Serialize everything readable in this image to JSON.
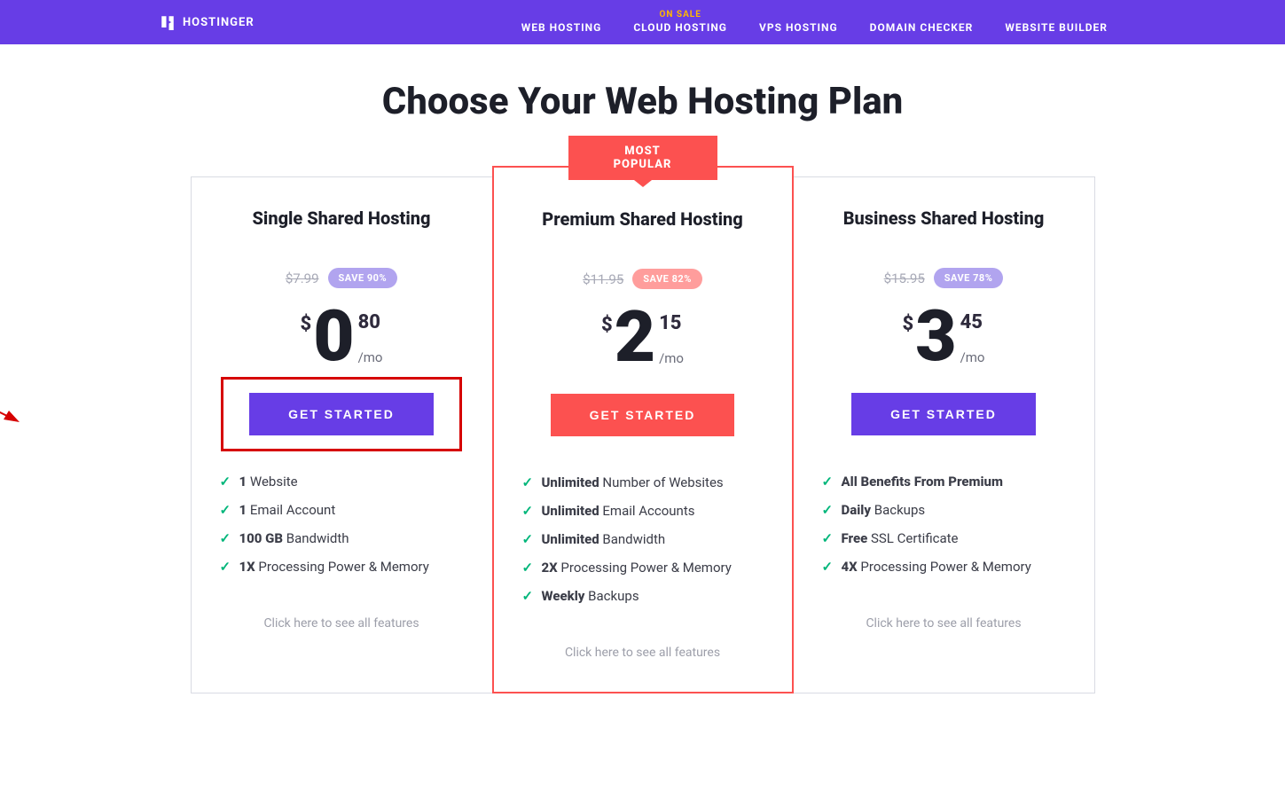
{
  "brand": "HOSTINGER",
  "nav": {
    "items": [
      {
        "label": "WEB HOSTING",
        "badge": ""
      },
      {
        "label": "CLOUD HOSTING",
        "badge": "ON SALE"
      },
      {
        "label": "VPS HOSTING",
        "badge": ""
      },
      {
        "label": "DOMAIN CHECKER",
        "badge": ""
      },
      {
        "label": "WEBSITE BUILDER",
        "badge": ""
      }
    ]
  },
  "page_title": "Choose Your Web Hosting Plan",
  "popular_label": "MOST POPULAR",
  "plans": [
    {
      "title": "Single Shared Hosting",
      "old_price": "$7.99",
      "save": "SAVE 90%",
      "currency": "$",
      "big": "0",
      "cents": "80",
      "per": "/mo",
      "cta": "GET STARTED",
      "features": [
        {
          "bold": "1",
          "rest": " Website"
        },
        {
          "bold": "1",
          "rest": " Email Account"
        },
        {
          "bold": "100 GB",
          "rest": " Bandwidth"
        },
        {
          "bold": "1X",
          "rest": " Processing Power & Memory"
        }
      ],
      "see_all": "Click here to see all features"
    },
    {
      "title": "Premium Shared Hosting",
      "old_price": "$11.95",
      "save": "SAVE 82%",
      "currency": "$",
      "big": "2",
      "cents": "15",
      "per": "/mo",
      "cta": "GET STARTED",
      "features": [
        {
          "bold": "Unlimited",
          "rest": " Number of Websites"
        },
        {
          "bold": "Unlimited",
          "rest": " Email Accounts"
        },
        {
          "bold": "Unlimited",
          "rest": " Bandwidth"
        },
        {
          "bold": "2X",
          "rest": " Processing Power & Memory"
        },
        {
          "bold": "Weekly",
          "rest": " Backups"
        }
      ],
      "see_all": "Click here to see all features"
    },
    {
      "title": "Business Shared Hosting",
      "old_price": "$15.95",
      "save": "SAVE 78%",
      "currency": "$",
      "big": "3",
      "cents": "45",
      "per": "/mo",
      "cta": "GET STARTED",
      "features": [
        {
          "bold": "All Benefits From Premium",
          "rest": ""
        },
        {
          "bold": "Daily",
          "rest": " Backups"
        },
        {
          "bold": "Free",
          "rest": " SSL Certificate"
        },
        {
          "bold": "4X",
          "rest": " Processing Power & Memory"
        }
      ],
      "see_all": "Click here to see all features"
    }
  ]
}
